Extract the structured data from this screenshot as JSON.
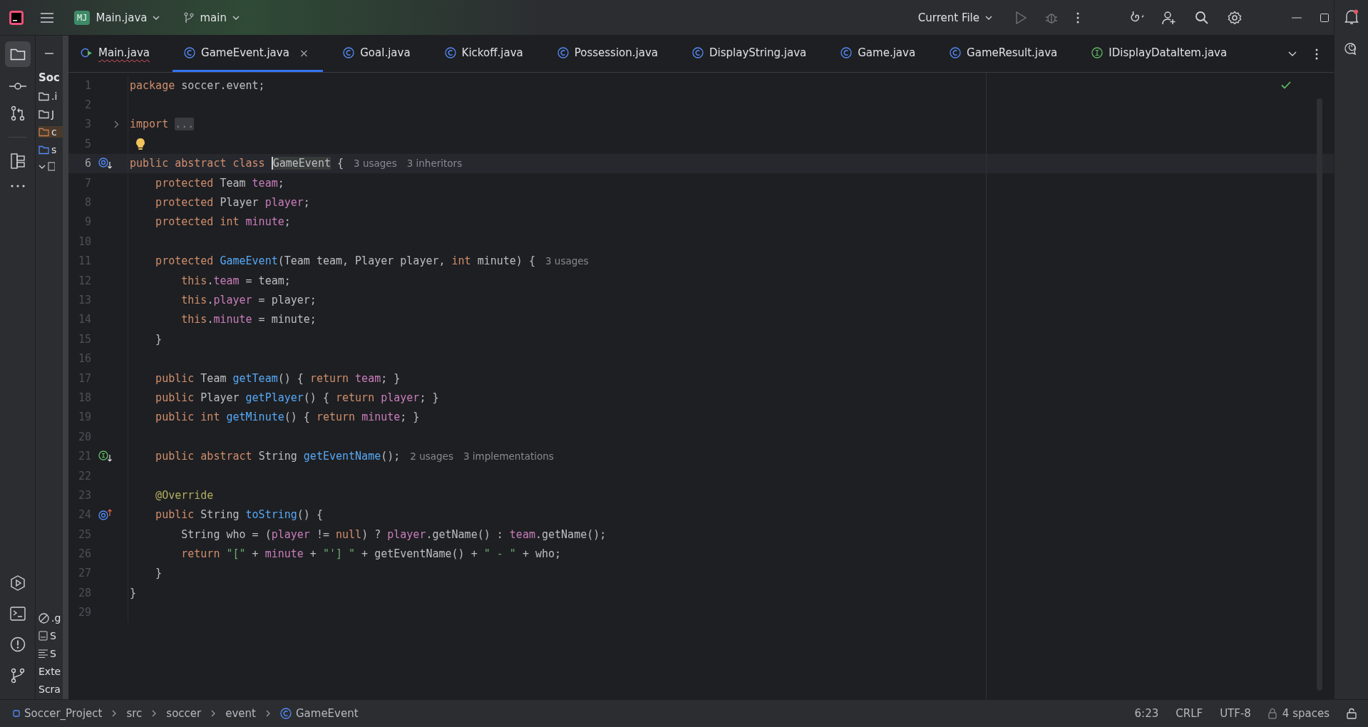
{
  "title_bar": {
    "project_badge": "MJ",
    "project": "Main.java",
    "branch": "main",
    "run_config": "Current File"
  },
  "tabs": [
    {
      "label": "Main.java",
      "kind": "main",
      "selected": false,
      "error": true,
      "closable": false
    },
    {
      "label": "GameEvent.java",
      "kind": "class",
      "selected": true,
      "error": false,
      "closable": true,
      "close": "×"
    },
    {
      "label": "Goal.java",
      "kind": "class",
      "selected": false,
      "error": false,
      "closable": false
    },
    {
      "label": "Kickoff.java",
      "kind": "class",
      "selected": false,
      "error": false,
      "closable": false
    },
    {
      "label": "Possession.java",
      "kind": "class",
      "selected": false,
      "error": false,
      "closable": false
    },
    {
      "label": "DisplayString.java",
      "kind": "class",
      "selected": false,
      "error": false,
      "closable": false
    },
    {
      "label": "Game.java",
      "kind": "class",
      "selected": false,
      "error": false,
      "closable": false
    },
    {
      "label": "GameResult.java",
      "kind": "class",
      "selected": false,
      "error": false,
      "closable": false
    },
    {
      "label": "IDisplayDataItem.java",
      "kind": "interface",
      "selected": false,
      "error": false,
      "closable": false
    }
  ],
  "project_panel": {
    "header": "Soc",
    "items": [
      {
        "label": ".i",
        "kind": "folder",
        "selected": false
      },
      {
        "label": "J",
        "kind": "folder",
        "selected": false
      },
      {
        "label": "c",
        "kind": "folder-excluded",
        "selected": true
      },
      {
        "label": "s",
        "kind": "folder-source",
        "selected": false
      },
      {
        "kind": "module",
        "selected": false
      }
    ],
    "bottom_items": [
      {
        "label": ".g",
        "kind": "ignored"
      },
      {
        "label": "S",
        "kind": "file"
      },
      {
        "label": "S",
        "kind": "lines"
      },
      {
        "label": "Exte",
        "kind": "plain"
      },
      {
        "label": "Scra",
        "kind": "plain"
      }
    ]
  },
  "editor": {
    "lines": [
      {
        "n": "1",
        "kind": "code",
        "tokens": [
          {
            "text": "package ",
            "kind": "kw"
          },
          {
            "text": "soccer.event;",
            "kind": "plain"
          }
        ]
      },
      {
        "n": "2",
        "kind": "code"
      },
      {
        "n": "3",
        "kind": "fold",
        "tokens": [
          {
            "text": "import ",
            "kind": "kw"
          },
          {
            "text": "...",
            "kind": "folded"
          }
        ]
      },
      {
        "n": "5",
        "kind": "bulb"
      },
      {
        "n": "6",
        "kind": "inherited",
        "current": true,
        "tokens": [
          {
            "text": "public abstract class ",
            "kind": "kw"
          },
          {
            "text": "GameEvent",
            "kind": "caret"
          },
          {
            "text": " {",
            "kind": "plain"
          }
        ],
        "hints": [
          "3 usages",
          "3 inheritors"
        ]
      },
      {
        "n": "7",
        "kind": "code",
        "tokens": [
          {
            "text": "    protected ",
            "kind": "kw"
          },
          {
            "text": "Team ",
            "kind": "plain"
          },
          {
            "text": "team",
            "kind": "field"
          },
          {
            "text": ";",
            "kind": "plain"
          }
        ]
      },
      {
        "n": "8",
        "kind": "code",
        "tokens": [
          {
            "text": "    protected ",
            "kind": "kw"
          },
          {
            "text": "Player ",
            "kind": "plain"
          },
          {
            "text": "player",
            "kind": "field"
          },
          {
            "text": ";",
            "kind": "plain"
          }
        ]
      },
      {
        "n": "9",
        "kind": "code",
        "tokens": [
          {
            "text": "    protected int ",
            "kind": "kw"
          },
          {
            "text": "minute",
            "kind": "field"
          },
          {
            "text": ";",
            "kind": "plain"
          }
        ]
      },
      {
        "n": "10",
        "kind": "code"
      },
      {
        "n": "11",
        "kind": "code",
        "tokens": [
          {
            "text": "    protected ",
            "kind": "kw"
          },
          {
            "text": "GameEvent",
            "kind": "fn"
          },
          {
            "text": "(Team team, Player player, ",
            "kind": "plain"
          },
          {
            "text": "int ",
            "kind": "kw"
          },
          {
            "text": "minute) {",
            "kind": "plain"
          }
        ],
        "hints": [
          "3 usages"
        ]
      },
      {
        "n": "12",
        "kind": "code",
        "tokens": [
          {
            "text": "        this",
            "kind": "kw"
          },
          {
            "text": ".",
            "kind": "plain"
          },
          {
            "text": "team",
            "kind": "field"
          },
          {
            "text": " = team;",
            "kind": "plain"
          }
        ]
      },
      {
        "n": "13",
        "kind": "code",
        "tokens": [
          {
            "text": "        this",
            "kind": "kw"
          },
          {
            "text": ".",
            "kind": "plain"
          },
          {
            "text": "player",
            "kind": "field"
          },
          {
            "text": " = player;",
            "kind": "plain"
          }
        ]
      },
      {
        "n": "14",
        "kind": "code",
        "tokens": [
          {
            "text": "        this",
            "kind": "kw"
          },
          {
            "text": ".",
            "kind": "plain"
          },
          {
            "text": "minute",
            "kind": "field"
          },
          {
            "text": " = minute;",
            "kind": "plain"
          }
        ]
      },
      {
        "n": "15",
        "kind": "code",
        "tokens": [
          {
            "text": "    }",
            "kind": "plain"
          }
        ]
      },
      {
        "n": "16",
        "kind": "code"
      },
      {
        "n": "17",
        "kind": "code",
        "tokens": [
          {
            "text": "    public ",
            "kind": "kw"
          },
          {
            "text": "Team ",
            "kind": "plain"
          },
          {
            "text": "getTeam",
            "kind": "fn"
          },
          {
            "text": "() { ",
            "kind": "plain"
          },
          {
            "text": "return ",
            "kind": "kw"
          },
          {
            "text": "team",
            "kind": "field"
          },
          {
            "text": "; }",
            "kind": "plain"
          }
        ]
      },
      {
        "n": "18",
        "kind": "code",
        "tokens": [
          {
            "text": "    public ",
            "kind": "kw"
          },
          {
            "text": "Player ",
            "kind": "plain"
          },
          {
            "text": "getPlayer",
            "kind": "fn"
          },
          {
            "text": "() { ",
            "kind": "plain"
          },
          {
            "text": "return ",
            "kind": "kw"
          },
          {
            "text": "player",
            "kind": "field"
          },
          {
            "text": "; }",
            "kind": "plain"
          }
        ]
      },
      {
        "n": "19",
        "kind": "code",
        "tokens": [
          {
            "text": "    public int ",
            "kind": "kw"
          },
          {
            "text": "getMinute",
            "kind": "fn"
          },
          {
            "text": "() { ",
            "kind": "plain"
          },
          {
            "text": "return ",
            "kind": "kw"
          },
          {
            "text": "minute",
            "kind": "field"
          },
          {
            "text": "; }",
            "kind": "plain"
          }
        ]
      },
      {
        "n": "20",
        "kind": "code"
      },
      {
        "n": "21",
        "kind": "implemented",
        "tokens": [
          {
            "text": "    public abstract ",
            "kind": "kw"
          },
          {
            "text": "String ",
            "kind": "plain"
          },
          {
            "text": "getEventName",
            "kind": "fn"
          },
          {
            "text": "();",
            "kind": "plain"
          }
        ],
        "hints": [
          "2 usages",
          "3 implementations"
        ]
      },
      {
        "n": "22",
        "kind": "code"
      },
      {
        "n": "23",
        "kind": "code",
        "tokens": [
          {
            "text": "    @Override",
            "kind": "ann"
          }
        ]
      },
      {
        "n": "24",
        "kind": "overrides",
        "tokens": [
          {
            "text": "    public ",
            "kind": "kw"
          },
          {
            "text": "String ",
            "kind": "plain"
          },
          {
            "text": "toString",
            "kind": "fn"
          },
          {
            "text": "() {",
            "kind": "plain"
          }
        ]
      },
      {
        "n": "25",
        "kind": "code",
        "tokens": [
          {
            "text": "        String who = (",
            "kind": "plain"
          },
          {
            "text": "player",
            "kind": "field"
          },
          {
            "text": " != ",
            "kind": "plain"
          },
          {
            "text": "null",
            "kind": "kw"
          },
          {
            "text": ") ? ",
            "kind": "plain"
          },
          {
            "text": "player",
            "kind": "field"
          },
          {
            "text": ".getName() : ",
            "kind": "plain"
          },
          {
            "text": "team",
            "kind": "field"
          },
          {
            "text": ".getName();",
            "kind": "plain"
          }
        ]
      },
      {
        "n": "26",
        "kind": "code",
        "tokens": [
          {
            "text": "        return ",
            "kind": "kw"
          },
          {
            "text": "\"[\"",
            "kind": "str"
          },
          {
            "text": " + ",
            "kind": "plain"
          },
          {
            "text": "minute",
            "kind": "field"
          },
          {
            "text": " + ",
            "kind": "plain"
          },
          {
            "text": "\"'] \"",
            "kind": "str"
          },
          {
            "text": " + getEventName() + ",
            "kind": "plain"
          },
          {
            "text": "\" - \"",
            "kind": "str"
          },
          {
            "text": " + who;",
            "kind": "plain"
          }
        ]
      },
      {
        "n": "27",
        "kind": "code",
        "tokens": [
          {
            "text": "    }",
            "kind": "plain"
          }
        ]
      },
      {
        "n": "28",
        "kind": "code",
        "tokens": [
          {
            "text": "}",
            "kind": "plain"
          }
        ]
      },
      {
        "n": "29",
        "kind": "code"
      }
    ]
  },
  "status_bar": {
    "breadcrumbs": [
      {
        "label": "Soccer_Project",
        "kind": "module"
      },
      {
        "label": "src",
        "kind": "plain"
      },
      {
        "label": "soccer",
        "kind": "plain"
      },
      {
        "label": "event",
        "kind": "plain"
      },
      {
        "label": "GameEvent",
        "kind": "class"
      }
    ],
    "position": "6:23",
    "line_separator": "CRLF",
    "encoding": "UTF-8",
    "indent": "4 spaces"
  }
}
